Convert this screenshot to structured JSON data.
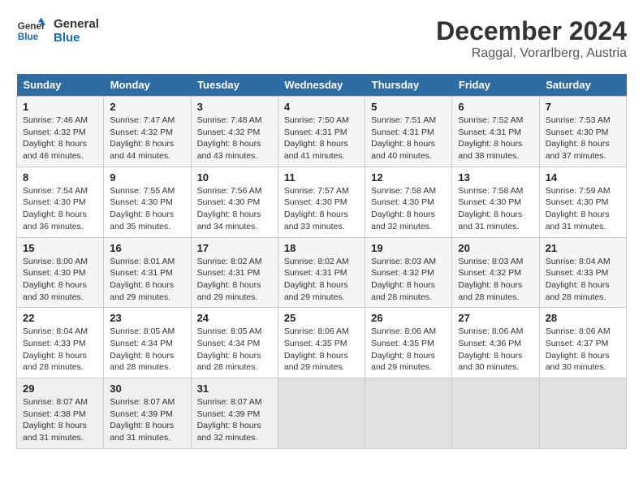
{
  "logo": {
    "text_general": "General",
    "text_blue": "Blue"
  },
  "title": "December 2024",
  "subtitle": "Raggal, Vorarlberg, Austria",
  "weekdays": [
    "Sunday",
    "Monday",
    "Tuesday",
    "Wednesday",
    "Thursday",
    "Friday",
    "Saturday"
  ],
  "weeks": [
    [
      {
        "day": "1",
        "info": "Sunrise: 7:46 AM\nSunset: 4:32 PM\nDaylight: 8 hours\nand 46 minutes."
      },
      {
        "day": "2",
        "info": "Sunrise: 7:47 AM\nSunset: 4:32 PM\nDaylight: 8 hours\nand 44 minutes."
      },
      {
        "day": "3",
        "info": "Sunrise: 7:48 AM\nSunset: 4:32 PM\nDaylight: 8 hours\nand 43 minutes."
      },
      {
        "day": "4",
        "info": "Sunrise: 7:50 AM\nSunset: 4:31 PM\nDaylight: 8 hours\nand 41 minutes."
      },
      {
        "day": "5",
        "info": "Sunrise: 7:51 AM\nSunset: 4:31 PM\nDaylight: 8 hours\nand 40 minutes."
      },
      {
        "day": "6",
        "info": "Sunrise: 7:52 AM\nSunset: 4:31 PM\nDaylight: 8 hours\nand 38 minutes."
      },
      {
        "day": "7",
        "info": "Sunrise: 7:53 AM\nSunset: 4:30 PM\nDaylight: 8 hours\nand 37 minutes."
      }
    ],
    [
      {
        "day": "8",
        "info": "Sunrise: 7:54 AM\nSunset: 4:30 PM\nDaylight: 8 hours\nand 36 minutes."
      },
      {
        "day": "9",
        "info": "Sunrise: 7:55 AM\nSunset: 4:30 PM\nDaylight: 8 hours\nand 35 minutes."
      },
      {
        "day": "10",
        "info": "Sunrise: 7:56 AM\nSunset: 4:30 PM\nDaylight: 8 hours\nand 34 minutes."
      },
      {
        "day": "11",
        "info": "Sunrise: 7:57 AM\nSunset: 4:30 PM\nDaylight: 8 hours\nand 33 minutes."
      },
      {
        "day": "12",
        "info": "Sunrise: 7:58 AM\nSunset: 4:30 PM\nDaylight: 8 hours\nand 32 minutes."
      },
      {
        "day": "13",
        "info": "Sunrise: 7:58 AM\nSunset: 4:30 PM\nDaylight: 8 hours\nand 31 minutes."
      },
      {
        "day": "14",
        "info": "Sunrise: 7:59 AM\nSunset: 4:30 PM\nDaylight: 8 hours\nand 31 minutes."
      }
    ],
    [
      {
        "day": "15",
        "info": "Sunrise: 8:00 AM\nSunset: 4:30 PM\nDaylight: 8 hours\nand 30 minutes."
      },
      {
        "day": "16",
        "info": "Sunrise: 8:01 AM\nSunset: 4:31 PM\nDaylight: 8 hours\nand 29 minutes."
      },
      {
        "day": "17",
        "info": "Sunrise: 8:02 AM\nSunset: 4:31 PM\nDaylight: 8 hours\nand 29 minutes."
      },
      {
        "day": "18",
        "info": "Sunrise: 8:02 AM\nSunset: 4:31 PM\nDaylight: 8 hours\nand 29 minutes."
      },
      {
        "day": "19",
        "info": "Sunrise: 8:03 AM\nSunset: 4:32 PM\nDaylight: 8 hours\nand 28 minutes."
      },
      {
        "day": "20",
        "info": "Sunrise: 8:03 AM\nSunset: 4:32 PM\nDaylight: 8 hours\nand 28 minutes."
      },
      {
        "day": "21",
        "info": "Sunrise: 8:04 AM\nSunset: 4:33 PM\nDaylight: 8 hours\nand 28 minutes."
      }
    ],
    [
      {
        "day": "22",
        "info": "Sunrise: 8:04 AM\nSunset: 4:33 PM\nDaylight: 8 hours\nand 28 minutes."
      },
      {
        "day": "23",
        "info": "Sunrise: 8:05 AM\nSunset: 4:34 PM\nDaylight: 8 hours\nand 28 minutes."
      },
      {
        "day": "24",
        "info": "Sunrise: 8:05 AM\nSunset: 4:34 PM\nDaylight: 8 hours\nand 28 minutes."
      },
      {
        "day": "25",
        "info": "Sunrise: 8:06 AM\nSunset: 4:35 PM\nDaylight: 8 hours\nand 29 minutes."
      },
      {
        "day": "26",
        "info": "Sunrise: 8:06 AM\nSunset: 4:35 PM\nDaylight: 8 hours\nand 29 minutes."
      },
      {
        "day": "27",
        "info": "Sunrise: 8:06 AM\nSunset: 4:36 PM\nDaylight: 8 hours\nand 30 minutes."
      },
      {
        "day": "28",
        "info": "Sunrise: 8:06 AM\nSunset: 4:37 PM\nDaylight: 8 hours\nand 30 minutes."
      }
    ],
    [
      {
        "day": "29",
        "info": "Sunrise: 8:07 AM\nSunset: 4:38 PM\nDaylight: 8 hours\nand 31 minutes."
      },
      {
        "day": "30",
        "info": "Sunrise: 8:07 AM\nSunset: 4:39 PM\nDaylight: 8 hours\nand 31 minutes."
      },
      {
        "day": "31",
        "info": "Sunrise: 8:07 AM\nSunset: 4:39 PM\nDaylight: 8 hours\nand 32 minutes."
      },
      null,
      null,
      null,
      null
    ]
  ]
}
